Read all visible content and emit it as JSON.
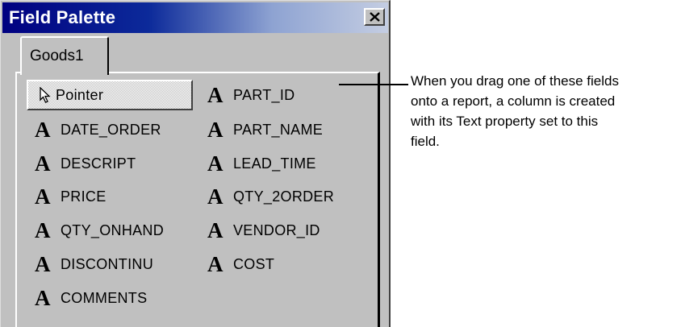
{
  "window": {
    "title": "Field Palette",
    "close_icon": "close-x-icon"
  },
  "tabs": [
    {
      "label": "Goods1",
      "active": true
    }
  ],
  "pointer_tool": {
    "label": "Pointer",
    "icon": "arrow-pointer-icon",
    "selected": true
  },
  "field_icon": "text-field-A-icon",
  "fields": [
    {
      "glyph": "A",
      "label": "PART_ID"
    },
    {
      "glyph": "A",
      "label": "DATE_ORDER"
    },
    {
      "glyph": "A",
      "label": "PART_NAME"
    },
    {
      "glyph": "A",
      "label": "DESCRIPT"
    },
    {
      "glyph": "A",
      "label": "LEAD_TIME"
    },
    {
      "glyph": "A",
      "label": "PRICE"
    },
    {
      "glyph": "A",
      "label": "QTY_2ORDER"
    },
    {
      "glyph": "A",
      "label": "QTY_ONHAND"
    },
    {
      "glyph": "A",
      "label": "VENDOR_ID"
    },
    {
      "glyph": "A",
      "label": "DISCONTINU"
    },
    {
      "glyph": "A",
      "label": "COST"
    },
    {
      "glyph": "A",
      "label": "COMMENTS"
    }
  ],
  "callout": {
    "lines": [
      "When you drag one of these fields",
      "onto a report, a column is created",
      "with its Text property set to this",
      "field."
    ]
  },
  "colors": {
    "titlebar_start": "#000080",
    "titlebar_end": "#c4cde2",
    "face": "#c0c0c0"
  }
}
